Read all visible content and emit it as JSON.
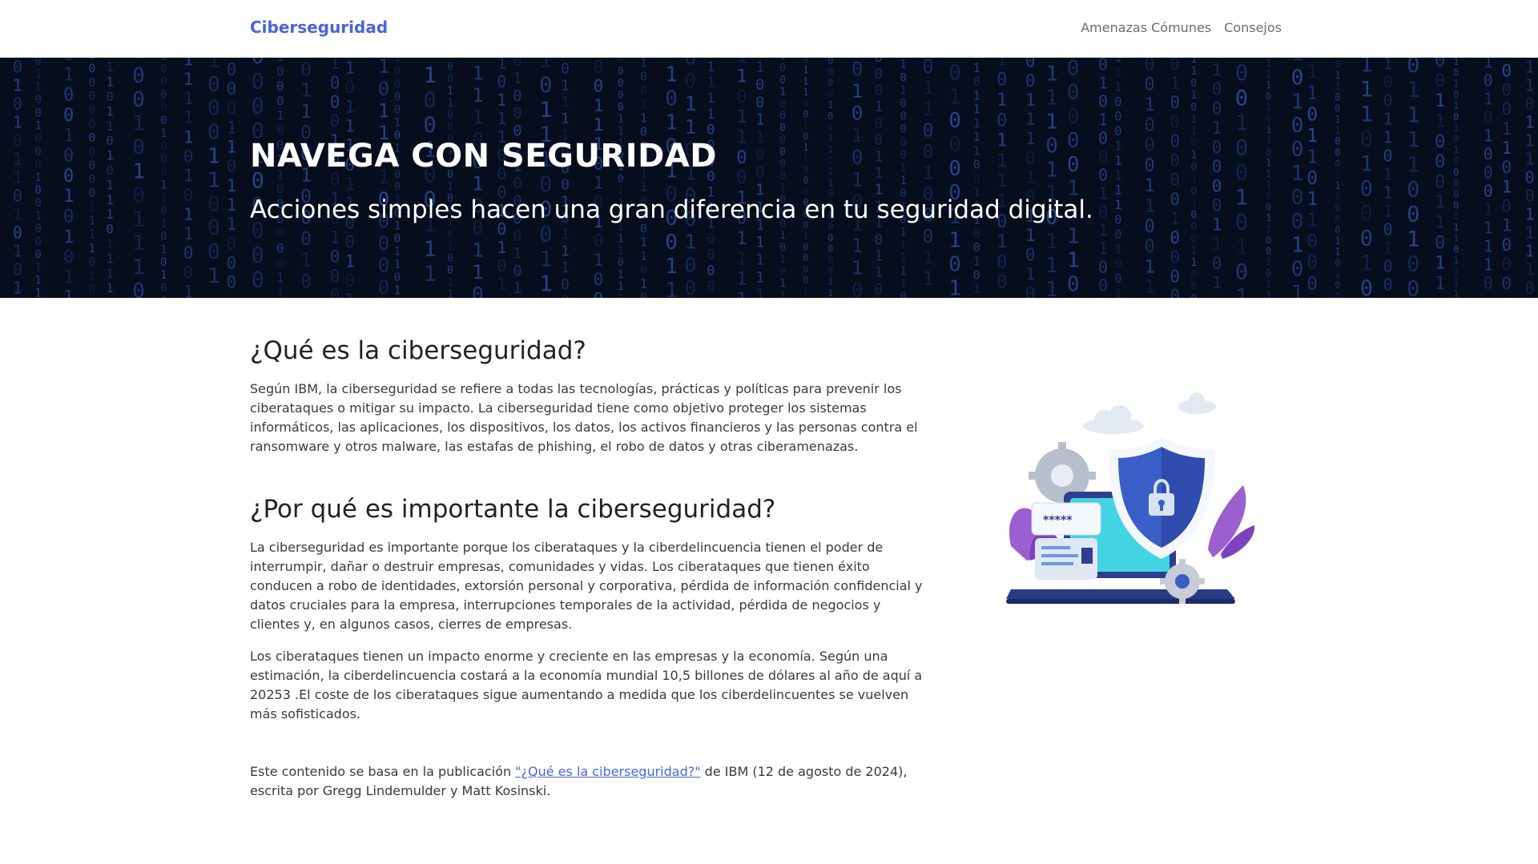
{
  "navbar": {
    "brand": "Ciberseguridad",
    "links": [
      "Amenazas Cómunes",
      "Consejos"
    ]
  },
  "hero": {
    "title": "NAVEGA CON SEGURIDAD",
    "subtitle": "Acciones simples hacen una gran diferencia en tu seguridad digital."
  },
  "sections": [
    {
      "title": "¿Qué es la ciberseguridad?",
      "paragraphs": [
        "Según IBM, la ciberseguridad se refiere a todas las tecnologías, prácticas y políticas para prevenir los ciberataques o mitigar su impacto. La ciberseguridad tiene como objetivo proteger los sistemas informáticos, las aplicaciones, los dispositivos, los datos, los activos financieros y las personas contra el ransomware y otros malware, las estafas de phishing, el robo de datos y otras ciberamenazas."
      ]
    },
    {
      "title": "¿Por qué es importante la ciberseguridad?",
      "paragraphs": [
        "La ciberseguridad es importante porque los ciberataques y la ciberdelincuencia tienen el poder de interrumpir, dañar o destruir empresas, comunidades y vidas. Los ciberataques que tienen éxito conducen a robo de identidades, extorsión personal y corporativa, pérdida de información confidencial y datos cruciales para la empresa, interrupciones temporales de la actividad, pérdida de negocios y clientes y, en algunos casos, cierres de empresas.",
        "Los ciberataques tienen un impacto enorme y creciente en las empresas y la economía. Según una estimación, la ciberdelincuencia costará a la economía mundial 10,5 billones de dólares al año de aquí a 20253 .El coste de los ciberataques sigue aumentando a medida que los ciberdelincuentes se vuelven más sofisticados."
      ]
    }
  ],
  "source": {
    "prefix": "Este contenido se basa en la publicación ",
    "link_text": "\"¿Qué es la ciberseguridad?\"",
    "suffix": " de IBM (12 de agosto de 2024), escrita por Gregg Lindemulder y Matt Kosinski."
  },
  "illustration": {
    "password_mask": "*****"
  },
  "colors": {
    "brand": "#4a63e0",
    "hero_bg": "#060d1d",
    "matrix_digit": "#3c6fd8"
  },
  "icons": [
    "shield-lock-icon",
    "gear-icon",
    "cloud-icon",
    "laptop-icon"
  ]
}
